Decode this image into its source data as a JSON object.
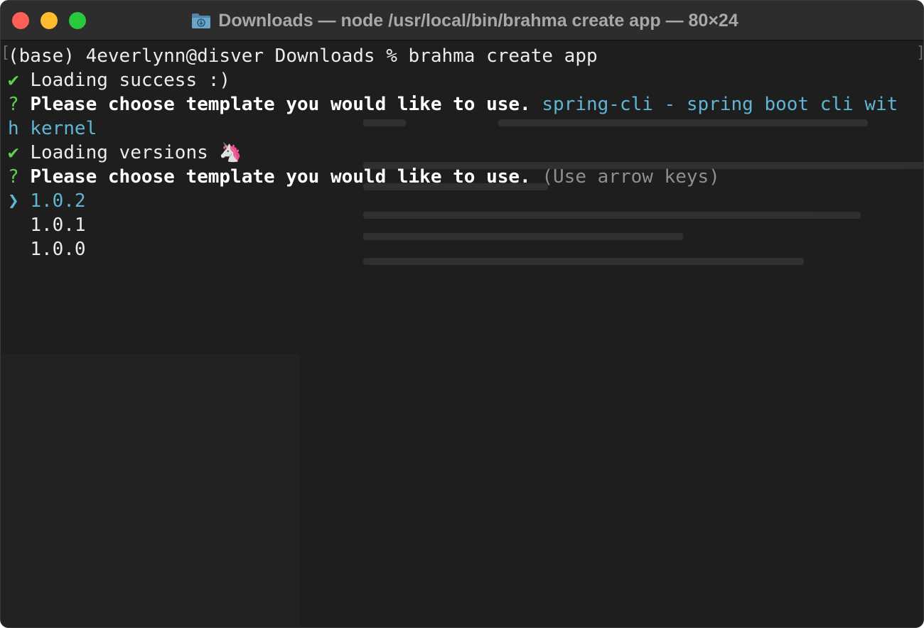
{
  "window": {
    "title": "Downloads — node /usr/local/bin/brahma create app — 80×24"
  },
  "terminal": {
    "prompt": "(base) 4everlynn@disver Downloads % brahma create app",
    "check_mark": "✔",
    "question_mark": "?",
    "pointer": "❯",
    "line_loading_success": "Loading success :)",
    "question_1": "Please choose template you would like to use.",
    "answer_1_part1": "spring-cli - spring boot cli wit",
    "answer_1_part2": "h kernel",
    "line_loading_versions": "Loading versions 🦄",
    "question_2": "Please choose template you would like to use.",
    "hint_2": "(Use arrow keys)",
    "options": [
      "1.0.2",
      "1.0.1",
      "1.0.0"
    ]
  },
  "colors": {
    "background": "#1e1e1e",
    "titlebar": "#2d2d2d",
    "success_green": "#5fcf4f",
    "selection_cyan": "#5fb6d4",
    "hint_gray": "#8f8f8f"
  }
}
